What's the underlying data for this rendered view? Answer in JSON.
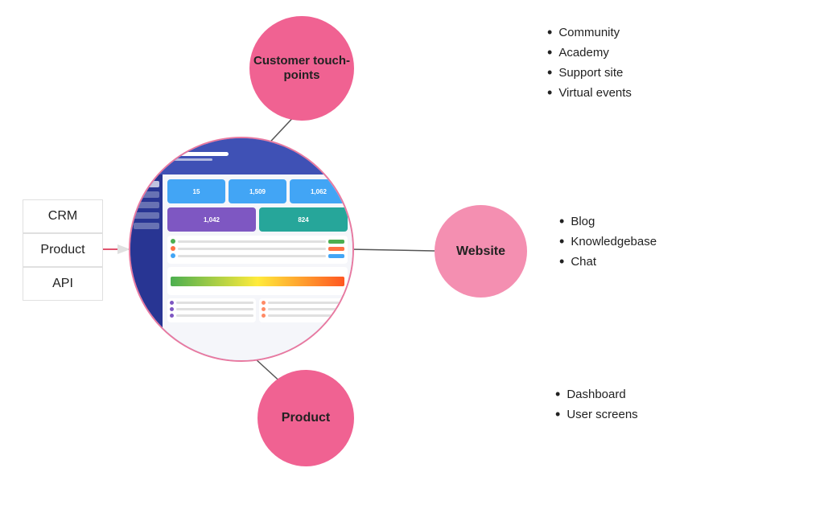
{
  "bubbles": {
    "top": {
      "label": "Customer touch-points"
    },
    "mid": {
      "label": "Website"
    },
    "bot": {
      "label": "Product"
    }
  },
  "leftBoxes": {
    "items": [
      "CRM",
      "Product",
      "API"
    ]
  },
  "bulletLists": {
    "top": [
      "Community",
      "Academy",
      "Support site",
      "Virtual events"
    ],
    "mid": [
      "Blog",
      "Knowledgebase",
      "Chat"
    ],
    "bot": [
      "Dashboard",
      "User screens"
    ]
  },
  "dashCards": [
    {
      "num": "15",
      "color": "blue"
    },
    {
      "num": "1,509",
      "color": "blue"
    },
    {
      "num": "1,062",
      "color": "blue"
    }
  ]
}
